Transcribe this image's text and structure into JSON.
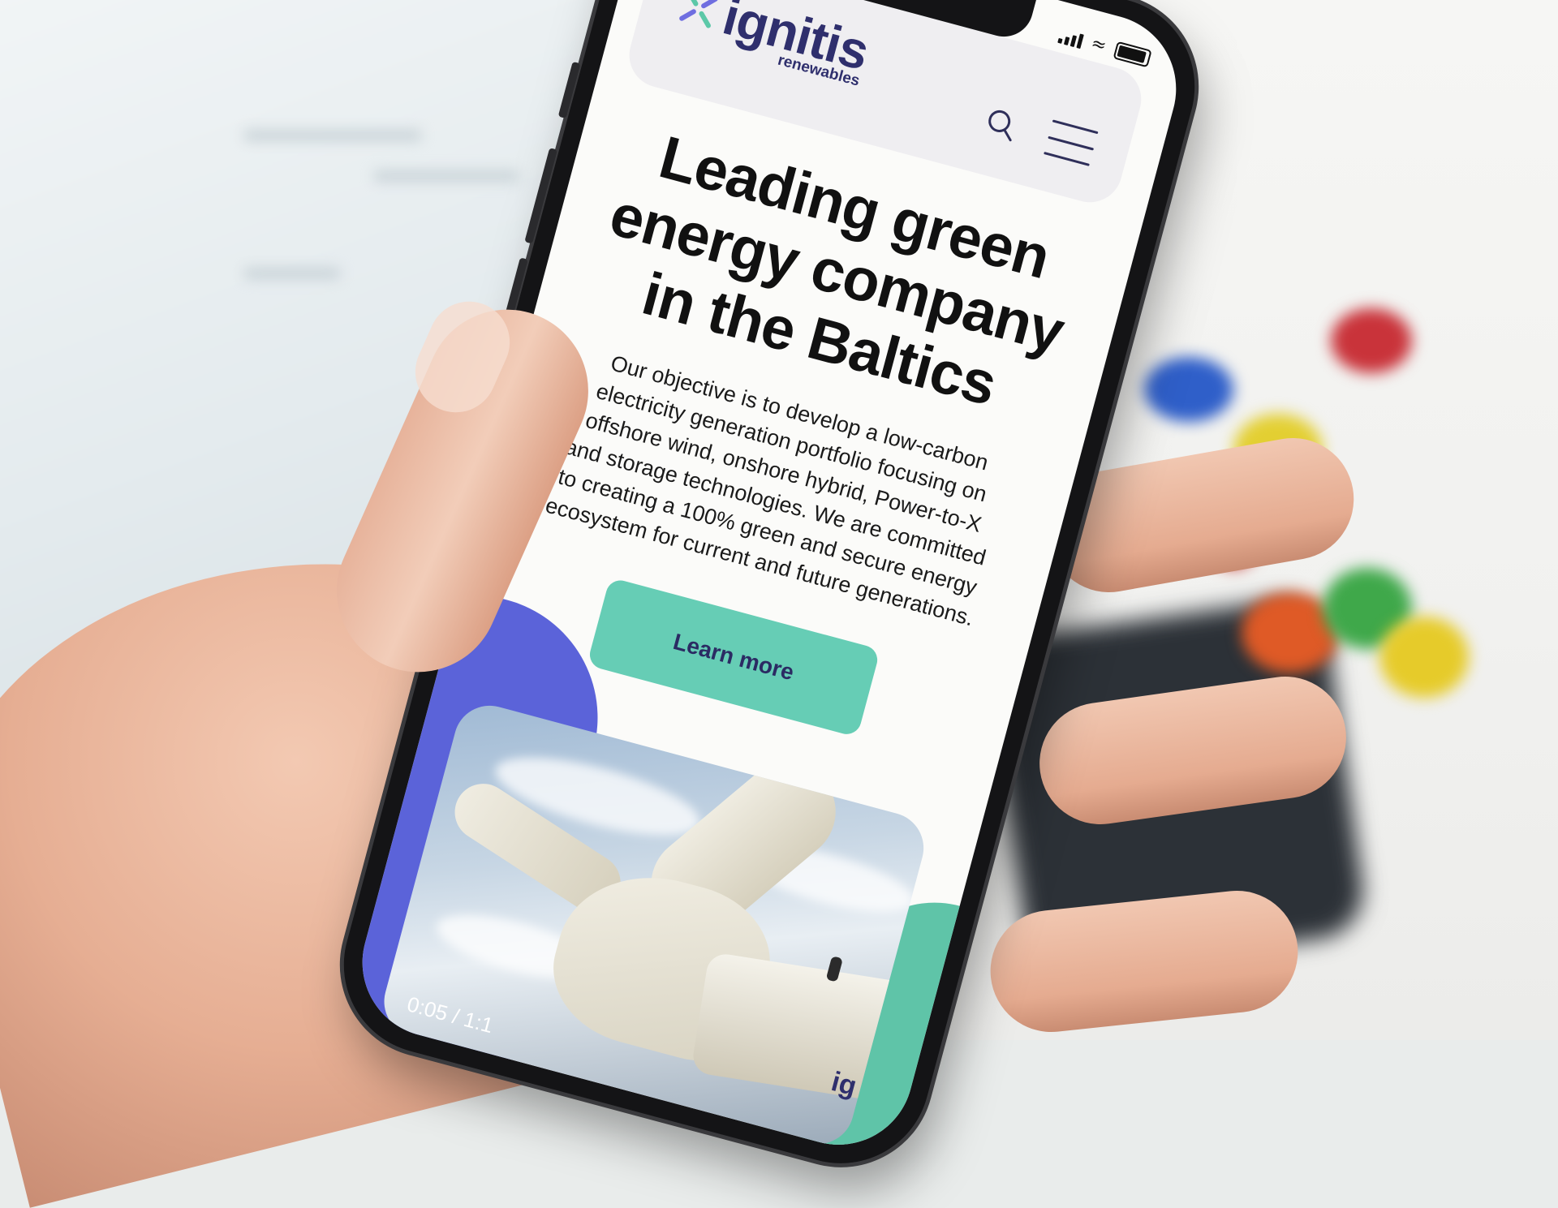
{
  "status_bar": {
    "wifi_icon": "wifi-icon",
    "battery_icon": "battery-icon",
    "signal_icon": "signal-icon"
  },
  "header": {
    "logo_word": "ignitis",
    "logo_sub": "renewables",
    "search_icon": "search-icon",
    "menu_icon": "hamburger-menu-icon"
  },
  "hero": {
    "title": "Leading green energy company in the Baltics",
    "description": "Our objective is to develop a low-carbon electricity generation portfolio focusing on offshore wind, onshore hybrid, Power-to-X and storage technologies. We are committed to creating a 100% green and secure energy ecosystem for current and future generations.",
    "cta_label": "Learn more"
  },
  "video": {
    "time": "0:05 / 1:1",
    "watermark": "ig"
  },
  "colors": {
    "brand_navy": "#2f2f6d",
    "cta_green": "#66cdb5",
    "blob_purple": "#5b63d9",
    "blob_green": "#5fc4a8",
    "logo_green": "#5cc8a8",
    "logo_purple": "#6f6ee0"
  }
}
